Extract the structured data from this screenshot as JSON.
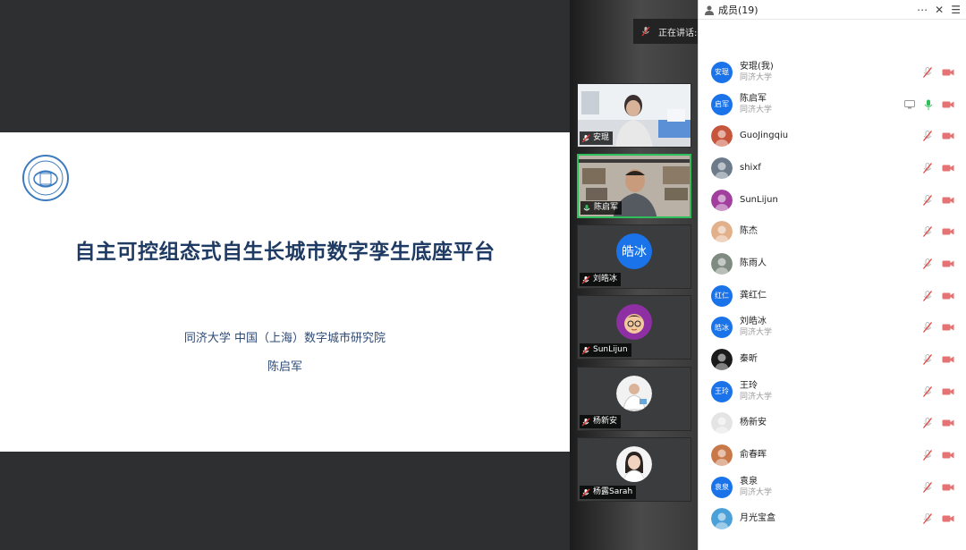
{
  "slide": {
    "title": "自主可控组态式自生长城市数字孪生底座平台",
    "organization": "同济大学 中国（上海）数字城市研究院",
    "author": "陈启军"
  },
  "speaking": {
    "text": "正在讲话: 陈启军;"
  },
  "video_tiles": [
    {
      "name": "安琨",
      "kind": "camera",
      "active": false
    },
    {
      "name": "陈启军",
      "kind": "camera",
      "active": true
    },
    {
      "name": "刘皓冰",
      "kind": "initials",
      "initials": "皓冰",
      "active": false
    },
    {
      "name": "SunLijun",
      "kind": "avatar",
      "active": false
    },
    {
      "name": "杨新安",
      "kind": "avatar",
      "active": false
    },
    {
      "name": "杨露Sarah",
      "kind": "avatar",
      "active": false
    }
  ],
  "panel": {
    "title": "成员(19)",
    "members": [
      {
        "name": "安琨(我)",
        "org": "同济大学",
        "avatar": "initials",
        "initials": "安琨",
        "mic": "muted"
      },
      {
        "name": "陈启军",
        "org": "同济大学",
        "avatar": "initials",
        "initials": "启军",
        "mic": "active",
        "sharing": true
      },
      {
        "name": "GuoJingqiu",
        "org": "",
        "avatar": "photo",
        "mic": "muted"
      },
      {
        "name": "shixf",
        "org": "",
        "avatar": "photo",
        "mic": "muted"
      },
      {
        "name": "SunLijun",
        "org": "",
        "avatar": "photo",
        "mic": "muted"
      },
      {
        "name": "陈杰",
        "org": "",
        "avatar": "photo",
        "mic": "muted"
      },
      {
        "name": "陈雨人",
        "org": "",
        "avatar": "photo",
        "mic": "muted"
      },
      {
        "name": "龚红仁",
        "org": "",
        "avatar": "initials",
        "initials": "红仁",
        "mic": "muted"
      },
      {
        "name": "刘皓冰",
        "org": "同济大学",
        "avatar": "initials",
        "initials": "皓冰",
        "mic": "muted"
      },
      {
        "name": "秦昕",
        "org": "",
        "avatar": "photo",
        "mic": "muted"
      },
      {
        "name": "王玲",
        "org": "同济大学",
        "avatar": "initials",
        "initials": "王玲",
        "mic": "muted"
      },
      {
        "name": "杨新安",
        "org": "",
        "avatar": "photo",
        "mic": "muted"
      },
      {
        "name": "俞春晖",
        "org": "",
        "avatar": "photo",
        "mic": "muted"
      },
      {
        "name": "袁泉",
        "org": "同济大学",
        "avatar": "initials",
        "initials": "袁泉",
        "mic": "muted"
      },
      {
        "name": "月光宝盒",
        "org": "",
        "avatar": "photo",
        "mic": "muted"
      }
    ]
  },
  "colors": {
    "accent": "#1a73e8",
    "active_speaker": "#2fbf5a",
    "muted_red": "#e53935",
    "title_blue": "#1f3b63"
  }
}
